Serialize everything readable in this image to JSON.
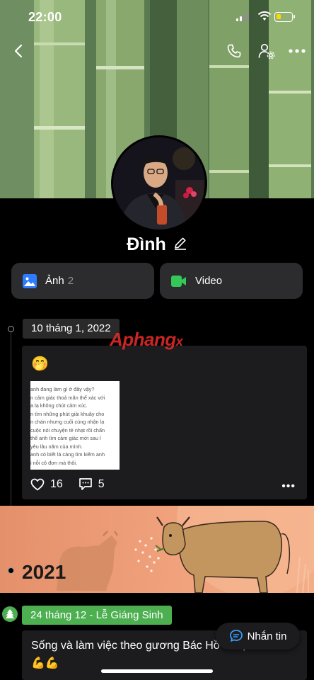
{
  "status": {
    "time": "22:00",
    "battery_level": 0.3,
    "battery_color": "#ffd60a"
  },
  "header": {
    "back_icon": "chevron-left-icon",
    "call_icon": "phone-icon",
    "settings_icon": "user-settings-icon",
    "more_icon": "more-horizontal-icon"
  },
  "profile": {
    "name": "Đình",
    "edit_icon": "pencil-icon"
  },
  "media": {
    "photos_label": "Ảnh",
    "photos_count": "2",
    "video_label": "Video",
    "photos_color": "#2f7bff",
    "video_color": "#34c759"
  },
  "timeline": {
    "post1": {
      "date": "10 tháng 1, 2022",
      "emoji": "🤭",
      "image_lines": [
        "anh đang làm gì ở đây vậy?",
        "n cảm giác thoả mãn thế xác với",
        "a lạ không chút cảm xúc.",
        "n tìm những phút giải khuây cho",
        "n chán nhưng cuối cùng nhận lạ",
        "cuộc nói chuyện tẻ nhạt rồi chấn",
        "thể anh tìm cảm giác mới sau l",
        "yêu lâu năm của mình.",
        "anh có biết là càng tìm kiếm anh",
        "i nỗi cô đơn mà thôi."
      ],
      "likes": "16",
      "comments": "5",
      "more": "•••"
    },
    "year": "2021",
    "post2": {
      "date": "24 tháng 12 - Lễ Giáng Sinh",
      "text": "Sống và làm việc theo gương Bác Hồ vĩ đại",
      "emojis": "💪💪",
      "accent_color": "#4caf50"
    }
  },
  "watermark": {
    "text": "Aphang",
    "suffix": "x"
  },
  "message_button": {
    "label": "Nhắn tin"
  }
}
